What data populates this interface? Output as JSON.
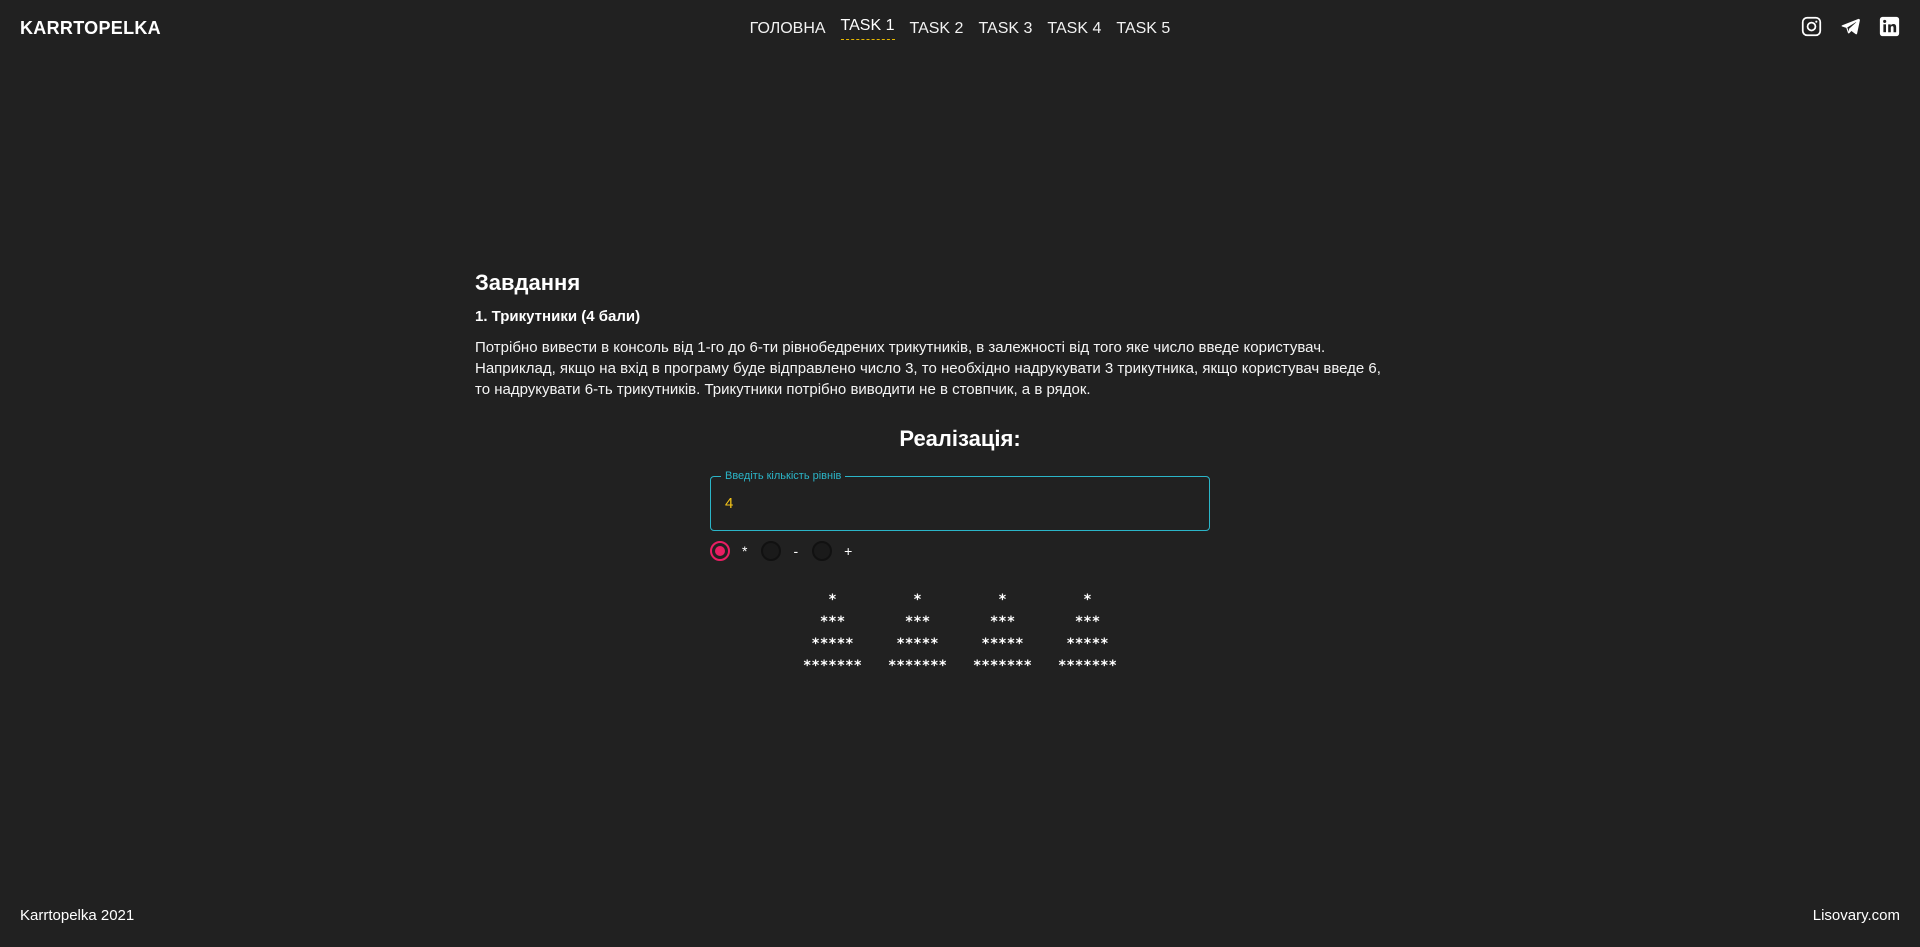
{
  "header": {
    "brand": "KARRTOPELKA",
    "nav": [
      {
        "label": "ГОЛОВНА",
        "active": false
      },
      {
        "label": "TASK 1",
        "active": true
      },
      {
        "label": "TASK 2",
        "active": false
      },
      {
        "label": "TASK 3",
        "active": false
      },
      {
        "label": "TASK 4",
        "active": false
      },
      {
        "label": "TASK 5",
        "active": false
      }
    ],
    "socials": [
      "instagram-icon",
      "telegram-icon",
      "linkedin-icon"
    ]
  },
  "task": {
    "heading": "Завдання",
    "subtitle": "1. Трикутники (4 бали)",
    "description_lines": [
      "Потрібно вивести в консоль від 1-го до 6-ти рівнобедрених трикутників, в залежності від того яке число введе користувач.",
      "Наприклад, якщо на вхід в програму буде відправлено число 3, то необхідно надрукувати 3 трикутника, якщо користувач введе 6,",
      "то надрукувати 6-ть трикутників. Трикутники потрібно виводити не в стовпчик, а в рядок."
    ]
  },
  "implementation": {
    "heading": "Реалізація:",
    "input_label": "Введіть кількість рівнів",
    "input_value": "4",
    "radio_options": [
      {
        "label": "*",
        "checked": true
      },
      {
        "label": "-",
        "checked": false
      },
      {
        "label": "+",
        "checked": false
      }
    ],
    "triangle_count": 4,
    "triangle_rows": [
      "*",
      "***",
      "*****",
      "*******"
    ]
  },
  "footer": {
    "left": "Karrtopelka 2021",
    "right": "Lisovary.com"
  },
  "colors": {
    "background": "#212121",
    "accent_field": "#2bb5c8",
    "input_value": "#f5c518",
    "radio_active": "#e91e63",
    "nav_underline": "#e6b800"
  }
}
